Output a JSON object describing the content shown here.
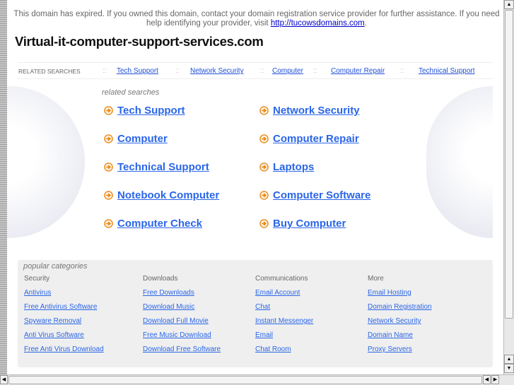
{
  "notice": {
    "text": "This domain has expired. If you owned this domain, contact your domain registration service provider for further assistance. If you need help identifying your provider, visit ",
    "link": "http://tucowsdomains.com",
    "end": "."
  },
  "title": "Virtual-it-computer-support-services.com",
  "related_bar": {
    "label": "RELATED SEARCHES",
    "separator": "::",
    "links": [
      "Tech Support",
      "Network Security",
      "Computer",
      "Computer Repair",
      "Technical Support"
    ]
  },
  "related": {
    "heading": "related searches",
    "links": [
      "Tech Support",
      "Network Security",
      "Computer",
      "Computer Repair",
      "Technical Support",
      "Laptops",
      "Notebook Computer",
      "Computer Software",
      "Computer Check",
      "Buy Computer"
    ]
  },
  "categories": {
    "heading": "popular categories",
    "columns": [
      {
        "title": "Security",
        "links": [
          "Antivirus",
          "Free Antivirus Software",
          "Spyware Removal",
          "Anti Virus Software",
          "Free Anti Virus Download"
        ]
      },
      {
        "title": "Downloads",
        "links": [
          "Free Downloads",
          "Download Music",
          "Download Full Movie",
          "Free Music Download",
          "Download Free Software"
        ]
      },
      {
        "title": "Communications",
        "links": [
          "Email Account",
          "Chat",
          "Instant Messenger",
          "Email",
          "Chat Room"
        ]
      },
      {
        "title": "More",
        "links": [
          "Email Hosting",
          "Domain Registration",
          "Network Security",
          "Domain Name",
          "Proxy Servers"
        ]
      }
    ]
  },
  "colors": {
    "link": "#2a66e8",
    "arrow": "#e8891a",
    "panel": "#efefef"
  }
}
